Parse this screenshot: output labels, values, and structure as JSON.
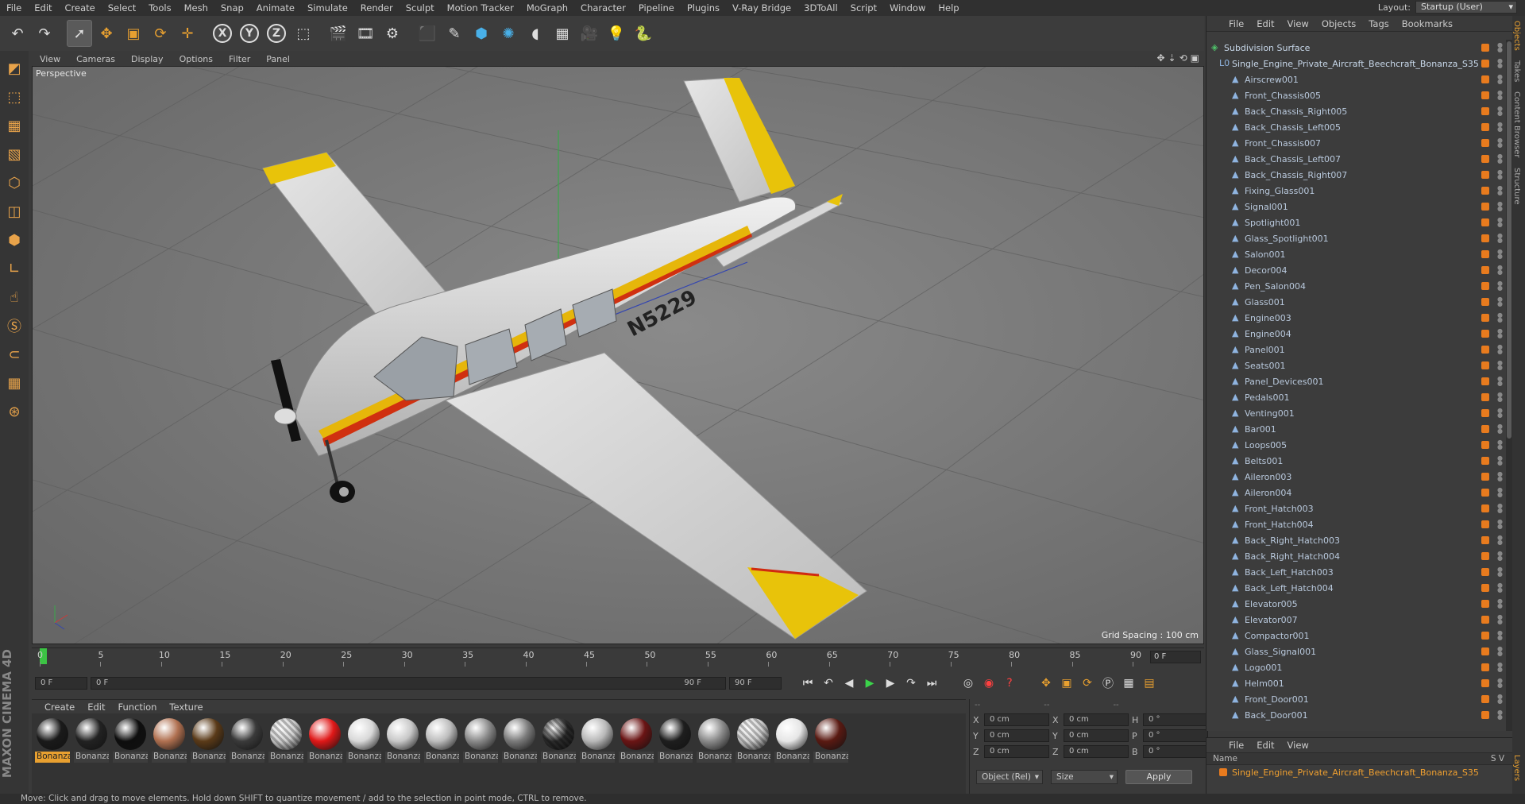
{
  "menubar": {
    "items": [
      "File",
      "Edit",
      "Create",
      "Select",
      "Tools",
      "Mesh",
      "Snap",
      "Animate",
      "Simulate",
      "Render",
      "Sculpt",
      "Motion Tracker",
      "MoGraph",
      "Character",
      "Pipeline",
      "Plugins",
      "V-Ray Bridge",
      "3DToAll",
      "Script",
      "Window",
      "Help"
    ],
    "layout_label": "Layout:",
    "layout_value": "Startup (User)"
  },
  "toolbar": {
    "icons": [
      "undo-icon",
      "redo-icon",
      "sep",
      "select-cursor-icon",
      "move-icon",
      "scale-icon",
      "rotate-icon",
      "live-select-icon",
      "sep",
      "x-axis-icon",
      "y-axis-icon",
      "z-axis-icon",
      "world-coord-icon",
      "sep",
      "render-view-icon",
      "render-picture-icon",
      "edit-render-settings-icon",
      "sep",
      "cube-icon",
      "pen-spline-icon",
      "subdivision-icon",
      "array-icon",
      "deformer-icon",
      "floor-icon",
      "camera-icon",
      "light-icon",
      "python-icon"
    ],
    "axis_x": "X",
    "axis_y": "Y",
    "axis_z": "Z"
  },
  "leftbar": {
    "icons": [
      "make-editable-icon",
      "model-mode-icon",
      "texture-mode-icon",
      "workplane-icon",
      "points-mode-icon",
      "edges-mode-icon",
      "polygons-mode-icon",
      "axis-mode-icon",
      "tweak-icon",
      "soft-selection-icon",
      "magnet-icon",
      "snap-grid-icon",
      "snap-settings-icon"
    ],
    "logo": "MAXON CINEMA 4D"
  },
  "viewport": {
    "menu": [
      "View",
      "Cameras",
      "Display",
      "Options",
      "Filter",
      "Panel"
    ],
    "label": "Perspective",
    "grid_spacing": "Grid Spacing : 100 cm",
    "registration": "N5229"
  },
  "timeline": {
    "ticks": [
      "0",
      "5",
      "10",
      "15",
      "20",
      "25",
      "30",
      "35",
      "40",
      "45",
      "50",
      "55",
      "60",
      "65",
      "70",
      "75",
      "80",
      "85",
      "90"
    ],
    "current_frame": "0 F"
  },
  "transport": {
    "start": "0 F",
    "range_start": "0 F",
    "range_end": "90 F",
    "end": "90 F"
  },
  "materials": {
    "menu": [
      "Create",
      "Edit",
      "Function",
      "Texture"
    ],
    "items": [
      {
        "name": "Bonanza",
        "color": "#1a1a1a",
        "selected": true
      },
      {
        "name": "Bonanza",
        "color": "#222222"
      },
      {
        "name": "Bonanza",
        "color": "#0e0e0e"
      },
      {
        "name": "Bonanza",
        "color": "#b07050"
      },
      {
        "name": "Bonanza",
        "color": "#5a3a18"
      },
      {
        "name": "Bonanza",
        "color": "#3a3a3a"
      },
      {
        "name": "Bonanza",
        "color": "#cfcfcf",
        "pattern": true
      },
      {
        "name": "Bonanza",
        "color": "#e01818"
      },
      {
        "name": "Bonanza",
        "color": "#d8d8d8"
      },
      {
        "name": "Bonanza",
        "color": "#c8c8c8"
      },
      {
        "name": "Bonanza",
        "color": "#bdbdbd"
      },
      {
        "name": "Bonanza",
        "color": "#8a8a8a"
      },
      {
        "name": "Bonanza",
        "color": "#7a7a7a"
      },
      {
        "name": "Bonanza",
        "color": "#2a2a2a",
        "pattern": true
      },
      {
        "name": "Bonanza",
        "color": "#b8b8b8"
      },
      {
        "name": "Bonanza",
        "color": "#6a1414"
      },
      {
        "name": "Bonanza",
        "color": "#1e1e1e"
      },
      {
        "name": "Bonanza",
        "color": "#8a8a8a"
      },
      {
        "name": "Bonanza",
        "color": "#d0d0d0",
        "pattern": true
      },
      {
        "name": "Bonanza",
        "color": "#e6e6e6"
      },
      {
        "name": "Bonanza",
        "color": "#5a1a12"
      }
    ]
  },
  "coords": {
    "header": [
      "--",
      "--",
      "--"
    ],
    "rows": [
      {
        "a": "X",
        "av": "0 cm",
        "b": "X",
        "bv": "0 cm",
        "c": "H",
        "cv": "0 °"
      },
      {
        "a": "Y",
        "av": "0 cm",
        "b": "Y",
        "bv": "0 cm",
        "c": "P",
        "cv": "0 °"
      },
      {
        "a": "Z",
        "av": "0 cm",
        "b": "Z",
        "bv": "0 cm",
        "c": "B",
        "cv": "0 °"
      }
    ],
    "mode": "Object (Rel)",
    "size": "Size",
    "apply": "Apply"
  },
  "object_manager": {
    "menu": [
      "File",
      "Edit",
      "View",
      "Objects",
      "Tags",
      "Bookmarks"
    ],
    "root": "Subdivision Surface",
    "group": "Single_Engine_Private_Aircraft_Beechcraft_Bonanza_S35",
    "children": [
      "Airscrew001",
      "Front_Chassis005",
      "Back_Chassis_Right005",
      "Back_Chassis_Left005",
      "Front_Chassis007",
      "Back_Chassis_Left007",
      "Back_Chassis_Right007",
      "Fixing_Glass001",
      "Signal001",
      "Spotlight001",
      "Glass_Spotlight001",
      "Salon001",
      "Decor004",
      "Pen_Salon004",
      "Glass001",
      "Engine003",
      "Engine004",
      "Panel001",
      "Seats001",
      "Panel_Devices001",
      "Pedals001",
      "Venting001",
      "Bar001",
      "Loops005",
      "Belts001",
      "Aileron003",
      "Aileron004",
      "Front_Hatch003",
      "Front_Hatch004",
      "Back_Right_Hatch003",
      "Back_Right_Hatch004",
      "Back_Left_Hatch003",
      "Back_Left_Hatch004",
      "Elevator005",
      "Elevator007",
      "Compactor001",
      "Glass_Signal001",
      "Logo001",
      "Helm001",
      "Front_Door001",
      "Back_Door001"
    ]
  },
  "side_tabs": [
    "Objects",
    "Takes",
    "Content Browser",
    "Structure"
  ],
  "layer_manager": {
    "menu": [
      "File",
      "Edit",
      "View"
    ],
    "name_header": "Name",
    "sv": "S V",
    "row": "Single_Engine_Private_Aircraft_Beechcraft_Bonanza_S35",
    "side_tab": "Layers"
  },
  "status": "Move: Click and drag to move elements. Hold down SHIFT to quantize movement / add to the selection in point mode, CTRL to remove."
}
